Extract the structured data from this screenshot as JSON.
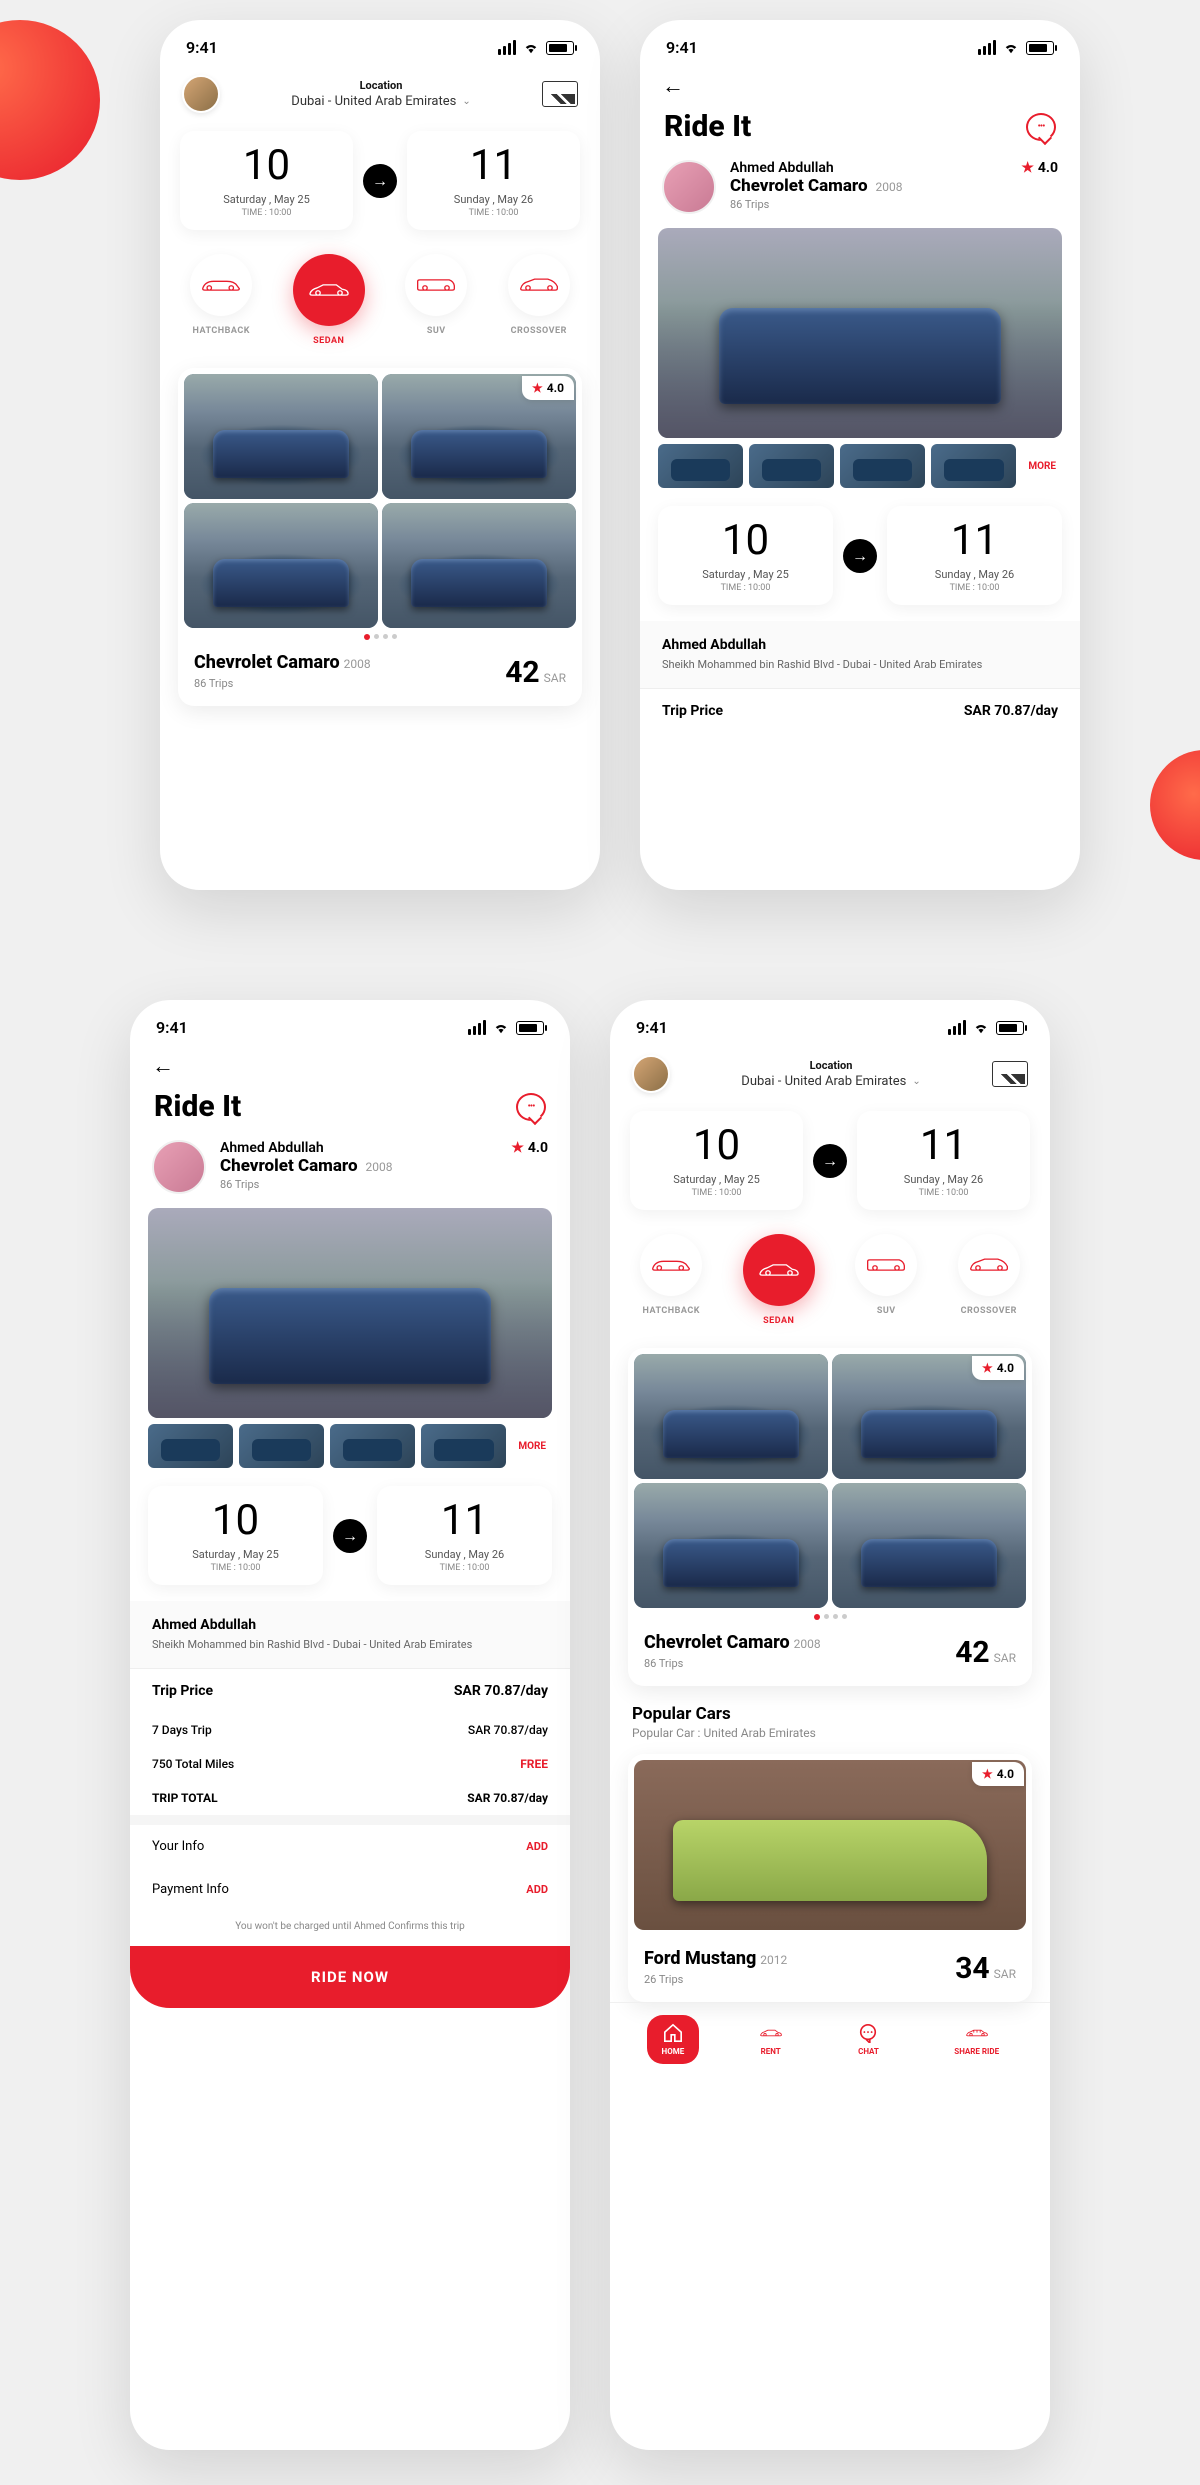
{
  "status": {
    "time": "9:41"
  },
  "location": {
    "label": "Location",
    "value": "Dubai - United Arab Emirates"
  },
  "app_title": "Ride It",
  "dates": {
    "start": {
      "num": "10",
      "day": "Saturday , May 25",
      "time": "TIME : 10:00"
    },
    "end": {
      "num": "11",
      "day": "Sunday , May 26",
      "time": "TIME : 10:00"
    }
  },
  "categories": [
    {
      "label": "HATCHBACK"
    },
    {
      "label": "SEDAN"
    },
    {
      "label": "SUV"
    },
    {
      "label": "CROSSOVER"
    }
  ],
  "listing": {
    "rating": "4.0",
    "name": "Chevrolet Camaro",
    "year": "2008",
    "trips": "86 Trips",
    "price": "42",
    "currency": "SAR"
  },
  "owner": {
    "name": "Ahmed Abdullah",
    "car": "Chevrolet Camaro",
    "year": "2008",
    "trips": "86 Trips",
    "rating": "4.0",
    "address": "Sheikh Mohammed bin Rashid Blvd - Dubai - United Arab Emirates"
  },
  "more": "MORE",
  "pricing": {
    "trip_price_label": "Trip Price",
    "trip_price_val": "SAR 70.87/day",
    "days_label": "7 Days Trip",
    "days_val": "SAR 70.87/day",
    "miles_label": "750 Total Miles",
    "miles_val": "FREE",
    "total_label": "TRIP TOTAL",
    "total_val": "SAR 70.87/day"
  },
  "checkout": {
    "your_info": "Your Info",
    "payment_info": "Payment Info",
    "add": "ADD",
    "disclaimer": "You won't be charged until Ahmed Confirms this trip",
    "ride_now": "RIDE NOW"
  },
  "popular": {
    "title": "Popular Cars",
    "subtitle": "Popular Car : United Arab Emirates",
    "car": {
      "name": "Ford Mustang",
      "year": "2012",
      "trips": "26 Trips",
      "price": "34",
      "currency": "SAR",
      "rating": "4.0"
    }
  },
  "nav": {
    "home": "HOME",
    "rent": "RENT",
    "chat": "CHAT",
    "share": "SHARE RIDE"
  }
}
